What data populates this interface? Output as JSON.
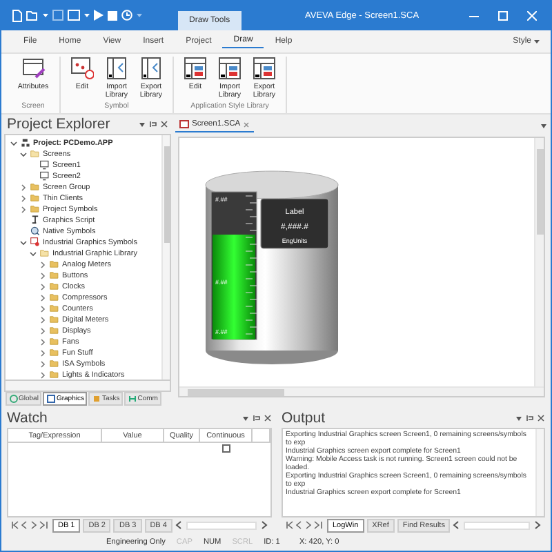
{
  "window": {
    "title": "AVEVA Edge - Screen1.SCA",
    "context_tab": "Draw Tools"
  },
  "menu": [
    {
      "label": "File",
      "selected": false
    },
    {
      "label": "Home",
      "selected": false
    },
    {
      "label": "View",
      "selected": false
    },
    {
      "label": "Insert",
      "selected": false
    },
    {
      "label": "Project",
      "selected": false
    },
    {
      "label": "Draw",
      "selected": true
    },
    {
      "label": "Help",
      "selected": false
    }
  ],
  "style_menu": "Style",
  "ribbon_groups": [
    {
      "name": "Screen",
      "buttons": [
        {
          "label": "Attributes",
          "kind": "attributes"
        }
      ]
    },
    {
      "name": "Symbol",
      "buttons": [
        {
          "label": "Edit",
          "kind": "symbol-edit"
        },
        {
          "label": "Import Library",
          "kind": "symbol-library"
        },
        {
          "label": "Export Library",
          "kind": "symbol-library"
        }
      ]
    },
    {
      "name": "Application Style Library",
      "buttons": [
        {
          "label": "Edit",
          "kind": "style-library"
        },
        {
          "label": "Import Library",
          "kind": "style-library"
        },
        {
          "label": "Export Library",
          "kind": "style-library"
        }
      ]
    }
  ],
  "project_explorer": {
    "title": "Project Explorer",
    "tree": [
      {
        "label": "Project: PCDemo.APP",
        "kind": "project",
        "expanded": true,
        "children": [
          {
            "label": "Screens",
            "kind": "folder-open",
            "expanded": true,
            "children": [
              {
                "label": "Screen1",
                "kind": "screen"
              },
              {
                "label": "Screen2",
                "kind": "screen"
              }
            ]
          },
          {
            "label": "Screen Group",
            "kind": "folder",
            "expanded": false
          },
          {
            "label": "Thin Clients",
            "kind": "folder",
            "expanded": false
          },
          {
            "label": "Project Symbols",
            "kind": "folder",
            "expanded": false
          },
          {
            "label": "Graphics Script",
            "kind": "script"
          },
          {
            "label": "Native Symbols",
            "kind": "native"
          },
          {
            "label": "Industrial Graphics Symbols",
            "kind": "symbols",
            "expanded": true,
            "children": [
              {
                "label": "Industrial Graphic Library",
                "kind": "folder-open",
                "expanded": true,
                "children": [
                  {
                    "label": "Analog Meters",
                    "kind": "folder",
                    "expanded": false
                  },
                  {
                    "label": "Buttons",
                    "kind": "folder",
                    "expanded": false
                  },
                  {
                    "label": "Clocks",
                    "kind": "folder",
                    "expanded": false
                  },
                  {
                    "label": "Compressors",
                    "kind": "folder",
                    "expanded": false
                  },
                  {
                    "label": "Counters",
                    "kind": "folder",
                    "expanded": false
                  },
                  {
                    "label": "Digital Meters",
                    "kind": "folder",
                    "expanded": false
                  },
                  {
                    "label": "Displays",
                    "kind": "folder",
                    "expanded": false
                  },
                  {
                    "label": "Fans",
                    "kind": "folder",
                    "expanded": false
                  },
                  {
                    "label": "Fun Stuff",
                    "kind": "folder",
                    "expanded": false
                  },
                  {
                    "label": "ISA Symbols",
                    "kind": "folder",
                    "expanded": false
                  },
                  {
                    "label": "Lights & Indicators",
                    "kind": "folder",
                    "expanded": false
                  }
                ]
              }
            ]
          }
        ]
      }
    ],
    "tabs": [
      {
        "label": "Global",
        "selected": false
      },
      {
        "label": "Graphics",
        "selected": true
      },
      {
        "label": "Tasks",
        "selected": false
      },
      {
        "label": "Comm",
        "selected": false
      }
    ]
  },
  "editor": {
    "tabs": [
      {
        "label": "Screen1.SCA",
        "selected": true
      }
    ],
    "tank": {
      "level": 0.71,
      "ticks": [
        "#.##",
        "#.##",
        "#.##"
      ],
      "display_label": "Label",
      "display_value": "#,###.#",
      "display_units": "EngUnits"
    }
  },
  "watch": {
    "title": "Watch",
    "columns": [
      "Tag/Expression",
      "Value",
      "Quality",
      "Continuous"
    ],
    "rows": [
      {
        "continuous": false
      }
    ],
    "tabs": [
      {
        "label": "DB 1",
        "selected": true
      },
      {
        "label": "DB 2",
        "selected": false
      },
      {
        "label": "DB 3",
        "selected": false
      },
      {
        "label": "DB 4",
        "selected": false
      }
    ]
  },
  "output": {
    "title": "Output",
    "lines": [
      "Exporting Industrial Graphics screen Screen1, 0 remaining screens/symbols to exp",
      "Industrial Graphics screen export complete for Screen1",
      "Warning: Mobile Access task is not running. Screen1 screen could not be loaded.",
      "Exporting Industrial Graphics screen Screen1, 0 remaining screens/symbols to exp",
      "Industrial Graphics screen export complete for Screen1"
    ],
    "tabs": [
      {
        "label": "LogWin",
        "selected": true
      },
      {
        "label": "XRef",
        "selected": false
      },
      {
        "label": "Find Results",
        "selected": false
      }
    ]
  },
  "status_bar": [
    {
      "text": "Engineering Only",
      "disabled": false
    },
    {
      "text": "CAP",
      "disabled": true
    },
    {
      "text": "NUM",
      "disabled": false
    },
    {
      "text": "SCRL",
      "disabled": true
    },
    {
      "text": "ID: 1",
      "disabled": false
    },
    {
      "text": "X: 420, Y: 0",
      "disabled": false
    }
  ]
}
